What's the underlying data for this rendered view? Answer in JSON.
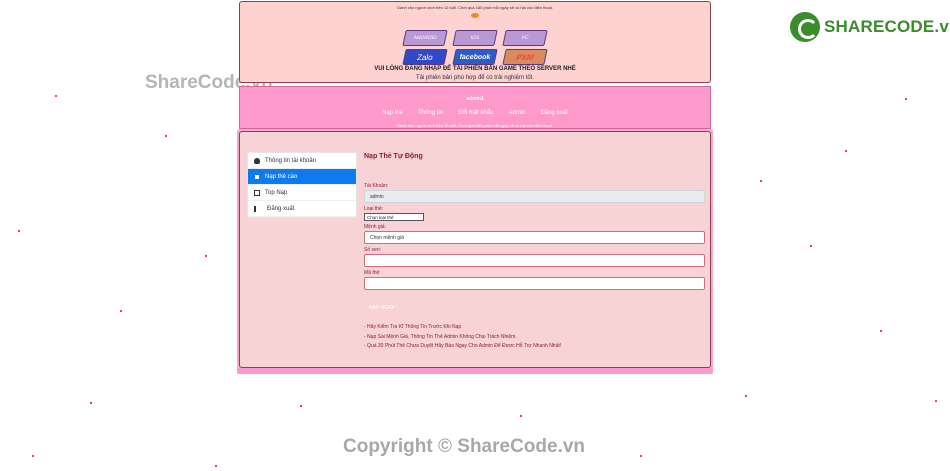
{
  "notice_small": "Dành cho người chơi trên 12 tuổi. Chơi quá 180 phút mỗi ngày sẽ có hại cho điện thoại.",
  "downloads": [
    "ANDROID",
    "IOS",
    "PC"
  ],
  "social": {
    "zalo": "Zalo",
    "facebook": "facebook",
    "pxm": "PXM"
  },
  "header_message": "VUI LÒNG ĐĂNG NHẬP ĐỂ TẢI PHIÊN BẢN GAME THEO SERVER NHÉ",
  "header_sub": "Tải phiên bản phù hợp để có trải nghiệm tốt.",
  "nav": {
    "username": "admin1",
    "links": [
      "Nạp thẻ",
      "Thông tin",
      "Đổi mật khẩu",
      "Admin",
      "Đăng xuất"
    ],
    "notice": "Dành cho người chơi trên 12 tuổi. Chơi quá 180 phút mỗi ngày sẽ có hại cho điện thoại."
  },
  "sidebar": {
    "items": [
      {
        "label": "Thông tin tài khoản"
      },
      {
        "label": "Nạp thẻ cào"
      },
      {
        "label": "Top Nạp"
      },
      {
        "label": "Đăng xuất"
      }
    ]
  },
  "form": {
    "title": "Nạp Thẻ Tự Động",
    "account_label": "Tài Khoản:",
    "account_value": "admin",
    "card_type_label": "Loại thẻ:",
    "card_type_value": "Chọn loại thẻ",
    "amount_label": "Mệnh giá:",
    "amount_value": "Chọn mệnh giá",
    "serial_label": "Số seri:",
    "serial_value": "",
    "code_label": "Mã thẻ:",
    "code_value": "",
    "submit_label": "NẠP NGAY"
  },
  "notes": [
    "- Hãy Kiểm Tra Kĩ Thông Tin Trước Khi Nạp",
    "- Nạp Sai Mệnh Giá, Thông Tin Thẻ Admin Không Chịu Trách Nhiệm.",
    "- Quá 30 Phút Thẻ Chưa Duyệt Hãy Báo Ngay Cho Admin Để Được Hỗ Trợ Nhanh Nhất!"
  ],
  "watermark": {
    "logo": "SHARECODE.vn",
    "top": "ShareCode.vn",
    "bottom": "Copyright © ShareCode.vn"
  },
  "colors": {
    "active_blue": "#0d7bef",
    "pink_nav": "#fd9acb",
    "label_red": "#8a1c3a"
  }
}
